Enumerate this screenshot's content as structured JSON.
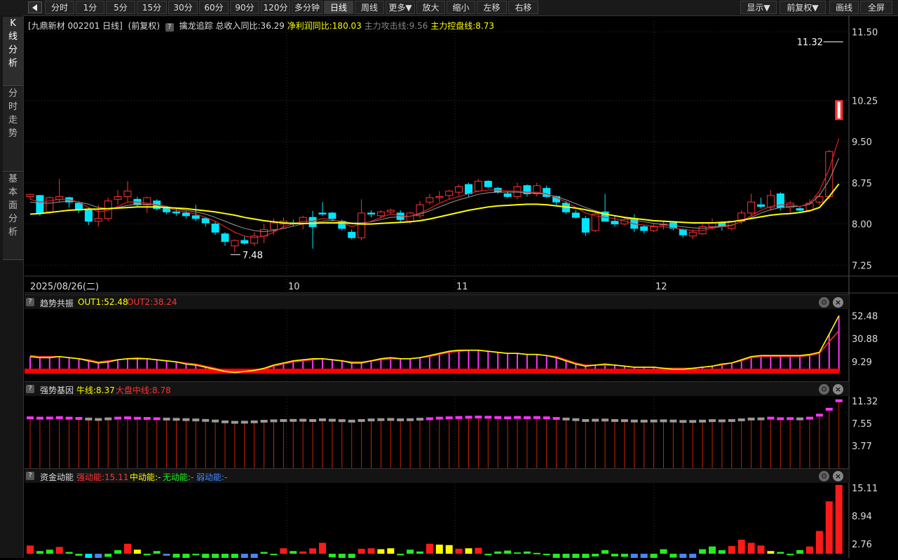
{
  "toolbar": {
    "periods": [
      "分时",
      "1分",
      "5分",
      "15分",
      "30分",
      "60分",
      "90分",
      "120分",
      "多分钟",
      "日线",
      "周线",
      "更多▼",
      "放大",
      "缩小",
      "左移",
      "右移"
    ],
    "active": "日线",
    "right": [
      "显示▼",
      "前复权▼",
      "画线",
      "全屏"
    ]
  },
  "sidebar": {
    "tabs": [
      "K线分析",
      "分时走势",
      "基本面分析"
    ]
  },
  "main": {
    "stock_label": "[九鼎新材 002201 日线]",
    "adjust": "(前复权)",
    "indicator_name": "擒龙追踪",
    "revenue": "总收入同比:36.29",
    "profit": "净利润同比:180.03",
    "attack": "主力攻击线:9.56",
    "control": "主力控盘线:8.73",
    "yticks": [
      "11.50",
      "10.25",
      "9.50",
      "8.75",
      "8.00",
      "7.25"
    ],
    "high_label": "11.32",
    "low_label": "7.48",
    "date_label": "2025/08/26(二)",
    "months": [
      "10",
      "11",
      "12"
    ]
  },
  "panel1": {
    "name": "趋势共振",
    "out1": "OUT1:52.48",
    "out2": "OUT2:38.24",
    "yticks": [
      "52.48",
      "30.88",
      "9.29"
    ]
  },
  "panel2": {
    "name": "强势基因",
    "bull": "牛线:8.37",
    "market": "大盘中线:8.78",
    "yticks": [
      "11.32",
      "7.55",
      "3.77"
    ]
  },
  "panel3": {
    "name": "资金动能",
    "strong": "强动能:15.11",
    "mid": "中动能:-",
    "none": "无动能:-",
    "weak": "弱动能:-",
    "yticks": [
      "15.11",
      "8.94",
      "2.76"
    ]
  },
  "colors": {
    "up": "#ff3333",
    "down": "#00e5ff",
    "yellow": "#ffff00",
    "magenta": "#ff33ff",
    "green": "#22ee22",
    "blue": "#4488ff"
  },
  "chart_data": {
    "type": "candlestick",
    "ylim": [
      7.1,
      11.7
    ],
    "ohlc": [
      [
        8.5,
        8.55,
        8.45,
        8.54
      ],
      [
        8.52,
        8.53,
        8.15,
        8.2
      ],
      [
        8.22,
        8.5,
        8.18,
        8.48
      ],
      [
        8.45,
        8.82,
        8.4,
        8.5
      ],
      [
        8.48,
        8.5,
        8.3,
        8.4
      ],
      [
        8.38,
        8.42,
        8.2,
        8.25
      ],
      [
        8.25,
        8.3,
        7.98,
        8.05
      ],
      [
        8.05,
        8.35,
        7.95,
        8.1
      ],
      [
        8.1,
        8.48,
        8.05,
        8.42
      ],
      [
        8.45,
        8.62,
        8.35,
        8.5
      ],
      [
        8.5,
        8.78,
        8.4,
        8.6
      ],
      [
        8.45,
        8.5,
        8.3,
        8.35
      ],
      [
        8.35,
        8.5,
        8.2,
        8.48
      ],
      [
        8.42,
        8.45,
        8.25,
        8.28
      ],
      [
        8.3,
        8.32,
        8.18,
        8.22
      ],
      [
        8.22,
        8.28,
        8.15,
        8.2
      ],
      [
        8.2,
        8.24,
        8.1,
        8.15
      ],
      [
        8.15,
        8.35,
        8.05,
        8.1
      ],
      [
        8.1,
        8.12,
        7.95,
        8.02
      ],
      [
        8.0,
        8.05,
        7.8,
        7.85
      ],
      [
        7.82,
        7.85,
        7.6,
        7.68
      ],
      [
        7.6,
        7.72,
        7.48,
        7.7
      ],
      [
        7.7,
        7.78,
        7.62,
        7.65
      ],
      [
        7.65,
        7.85,
        7.6,
        7.78
      ],
      [
        7.78,
        8.0,
        7.65,
        7.9
      ],
      [
        7.9,
        8.1,
        7.8,
        8.02
      ],
      [
        8.0,
        8.12,
        7.92,
        8.05
      ],
      [
        8.02,
        8.08,
        7.95,
        8.0
      ],
      [
        8.0,
        8.15,
        7.9,
        8.12
      ],
      [
        8.12,
        8.24,
        7.55,
        7.95
      ],
      [
        8.2,
        8.4,
        8.15,
        8.18
      ],
      [
        8.2,
        8.22,
        8.05,
        8.1
      ],
      [
        8.05,
        8.08,
        7.88,
        7.92
      ],
      [
        7.85,
        7.9,
        7.72,
        7.75
      ],
      [
        7.75,
        8.45,
        7.7,
        8.2
      ],
      [
        8.2,
        8.25,
        8.12,
        8.18
      ],
      [
        8.15,
        8.25,
        8.1,
        8.22
      ],
      [
        8.22,
        8.28,
        8.18,
        8.25
      ],
      [
        8.2,
        8.25,
        8.02,
        8.08
      ],
      [
        8.05,
        8.22,
        8.0,
        8.2
      ],
      [
        8.15,
        8.42,
        8.1,
        8.35
      ],
      [
        8.4,
        8.55,
        8.35,
        8.48
      ],
      [
        8.48,
        8.6,
        8.4,
        8.5
      ],
      [
        8.52,
        8.62,
        8.45,
        8.6
      ],
      [
        8.58,
        8.72,
        8.52,
        8.68
      ],
      [
        8.72,
        8.75,
        8.5,
        8.55
      ],
      [
        8.6,
        8.82,
        8.58,
        8.78
      ],
      [
        8.78,
        8.8,
        8.65,
        8.68
      ],
      [
        8.65,
        8.68,
        8.55,
        8.58
      ],
      [
        8.55,
        8.6,
        8.48,
        8.5
      ],
      [
        8.5,
        8.75,
        8.45,
        8.68
      ],
      [
        8.7,
        8.72,
        8.5,
        8.55
      ],
      [
        8.55,
        8.75,
        8.5,
        8.7
      ],
      [
        8.65,
        8.7,
        8.48,
        8.5
      ],
      [
        8.5,
        8.52,
        8.35,
        8.4
      ],
      [
        8.38,
        8.42,
        8.18,
        8.22
      ],
      [
        8.2,
        8.25,
        8.1,
        8.12
      ],
      [
        8.1,
        8.15,
        7.78,
        7.85
      ],
      [
        7.88,
        8.2,
        7.85,
        8.18
      ],
      [
        8.22,
        8.55,
        8.18,
        8.05
      ],
      [
        8.05,
        8.15,
        7.95,
        8.0
      ],
      [
        8.0,
        8.12,
        7.98,
        8.08
      ],
      [
        8.1,
        8.18,
        7.85,
        7.92
      ],
      [
        7.95,
        7.98,
        7.82,
        7.88
      ],
      [
        7.88,
        8.0,
        7.85,
        7.95
      ],
      [
        7.98,
        8.05,
        7.9,
        8.0
      ],
      [
        8.02,
        8.05,
        7.88,
        7.92
      ],
      [
        7.9,
        7.92,
        7.75,
        7.8
      ],
      [
        7.78,
        7.9,
        7.72,
        7.85
      ],
      [
        7.82,
        8.0,
        7.8,
        7.95
      ],
      [
        7.95,
        8.1,
        7.9,
        8.02
      ],
      [
        8.02,
        8.05,
        7.88,
        7.95
      ],
      [
        7.92,
        8.05,
        7.88,
        8.05
      ],
      [
        8.05,
        8.25,
        8.0,
        8.2
      ],
      [
        8.2,
        8.55,
        8.15,
        8.4
      ],
      [
        8.35,
        8.48,
        8.28,
        8.32
      ],
      [
        8.3,
        8.62,
        8.25,
        8.52
      ],
      [
        8.55,
        8.58,
        8.25,
        8.3
      ],
      [
        8.3,
        8.42,
        8.18,
        8.38
      ],
      [
        8.28,
        8.32,
        8.2,
        8.25
      ],
      [
        8.25,
        8.45,
        8.22,
        8.38
      ],
      [
        8.4,
        8.55,
        8.35,
        8.5
      ],
      [
        8.5,
        9.35,
        8.45,
        9.32
      ],
      [
        10.25,
        10.25,
        9.9,
        9.9
      ]
    ],
    "limit_up_last": true,
    "ma_yellow": [
      8.18,
      8.19,
      8.21,
      8.23,
      8.25,
      8.26,
      8.27,
      8.27,
      8.28,
      8.29,
      8.3,
      8.31,
      8.31,
      8.31,
      8.3,
      8.29,
      8.28,
      8.26,
      8.24,
      8.22,
      8.19,
      8.16,
      8.12,
      8.09,
      8.06,
      8.04,
      8.02,
      8.01,
      8.01,
      8.01,
      8.02,
      8.02,
      8.02,
      8.01,
      8.0,
      8.0,
      8.01,
      8.02,
      8.03,
      8.04,
      8.06,
      8.09,
      8.13,
      8.17,
      8.21,
      8.25,
      8.28,
      8.31,
      8.33,
      8.34,
      8.35,
      8.36,
      8.36,
      8.35,
      8.33,
      8.31,
      8.29,
      8.26,
      8.22,
      8.18,
      8.15,
      8.12,
      8.1,
      8.08,
      8.06,
      8.05,
      8.04,
      8.03,
      8.02,
      8.02,
      8.02,
      8.03,
      8.04,
      8.07,
      8.1,
      8.13,
      8.16,
      8.18,
      8.19,
      8.21,
      8.24,
      8.3,
      8.5,
      8.73
    ],
    "ma_red": [
      8.45,
      8.4,
      8.42,
      8.45,
      8.44,
      8.4,
      8.3,
      8.22,
      8.25,
      8.32,
      8.4,
      8.4,
      8.38,
      8.35,
      8.3,
      8.25,
      8.22,
      8.18,
      8.12,
      8.05,
      7.95,
      7.85,
      7.78,
      7.75,
      7.78,
      7.85,
      7.95,
      8.0,
      8.05,
      8.05,
      8.1,
      8.08,
      8.02,
      7.95,
      8.0,
      8.05,
      8.12,
      8.18,
      8.15,
      8.14,
      8.2,
      8.28,
      8.38,
      8.45,
      8.5,
      8.55,
      8.6,
      8.62,
      8.62,
      8.6,
      8.6,
      8.58,
      8.58,
      8.55,
      8.48,
      8.4,
      8.3,
      8.2,
      8.15,
      8.12,
      8.1,
      8.05,
      8.0,
      7.98,
      7.96,
      7.95,
      7.93,
      7.9,
      7.88,
      7.88,
      7.92,
      7.95,
      7.97,
      8.05,
      8.15,
      8.25,
      8.32,
      8.35,
      8.35,
      8.32,
      8.38,
      8.6,
      9.0,
      9.56
    ],
    "ma_gray": [
      8.4,
      8.38,
      8.38,
      8.4,
      8.42,
      8.4,
      8.36,
      8.3,
      8.28,
      8.3,
      8.34,
      8.36,
      8.36,
      8.35,
      8.32,
      8.28,
      8.25,
      8.22,
      8.18,
      8.12,
      8.05,
      7.98,
      7.92,
      7.88,
      7.86,
      7.88,
      7.92,
      7.96,
      8.0,
      8.02,
      8.05,
      8.06,
      8.05,
      8.02,
      8.02,
      8.04,
      8.08,
      8.12,
      8.13,
      8.14,
      8.18,
      8.24,
      8.31,
      8.38,
      8.44,
      8.49,
      8.54,
      8.57,
      8.58,
      8.58,
      8.58,
      8.57,
      8.56,
      8.54,
      8.5,
      8.44,
      8.37,
      8.3,
      8.24,
      8.19,
      8.15,
      8.11,
      8.07,
      8.04,
      8.01,
      7.99,
      7.97,
      7.95,
      7.93,
      7.92,
      7.94,
      7.96,
      7.98,
      8.04,
      8.12,
      8.2,
      8.26,
      8.3,
      8.32,
      8.32,
      8.36,
      8.52,
      8.8,
      9.2
    ],
    "panel1": {
      "ylim": [
        0,
        58
      ],
      "out1": [
        14,
        13,
        13,
        14,
        13,
        12,
        10,
        8,
        9,
        11,
        12,
        12,
        12,
        11,
        10,
        9,
        7,
        6,
        4,
        2,
        0,
        -1,
        0,
        1,
        3,
        6,
        8,
        10,
        11,
        12,
        12,
        11,
        10,
        8,
        8,
        10,
        12,
        13,
        12,
        12,
        13,
        15,
        17,
        19,
        20,
        20,
        20,
        19,
        18,
        17,
        17,
        16,
        16,
        15,
        13,
        10,
        7,
        5,
        6,
        7,
        6,
        5,
        4,
        4,
        4,
        3,
        2,
        2,
        3,
        4,
        5,
        7,
        8,
        11,
        14,
        15,
        15,
        15,
        15,
        15,
        16,
        18,
        35,
        52.48
      ],
      "out2": [
        15,
        14,
        14,
        14,
        13,
        12,
        11,
        9,
        10,
        11,
        12,
        13,
        12,
        11,
        10,
        9,
        8,
        7,
        5,
        3,
        1,
        0,
        0,
        1,
        2,
        5,
        7,
        9,
        10,
        11,
        12,
        11,
        10,
        9,
        9,
        10,
        11,
        12,
        12,
        12,
        13,
        14,
        16,
        18,
        19,
        20,
        20,
        19,
        18,
        17,
        17,
        16,
        16,
        15,
        14,
        11,
        8,
        6,
        6,
        6,
        6,
        5,
        4,
        4,
        4,
        3,
        3,
        3,
        3,
        4,
        5,
        6,
        8,
        10,
        13,
        14,
        14,
        14,
        14,
        14,
        15,
        17,
        28,
        38.24
      ]
    },
    "panel2": {
      "ylim": [
        0,
        12
      ],
      "bar_levels": [
        8.45,
        8.4,
        8.42,
        8.48,
        8.4,
        8.35,
        8.25,
        8.18,
        8.28,
        8.4,
        8.45,
        8.38,
        8.35,
        8.3,
        8.24,
        8.2,
        8.15,
        8.1,
        8.02,
        7.92,
        7.78,
        7.7,
        7.72,
        7.78,
        7.88,
        7.95,
        8.0,
        8.02,
        8.05,
        8.0,
        8.12,
        8.05,
        7.98,
        7.9,
        8.0,
        8.1,
        8.15,
        8.18,
        8.12,
        8.14,
        8.22,
        8.3,
        8.4,
        8.45,
        8.5,
        8.55,
        8.58,
        8.55,
        8.5,
        8.45,
        8.52,
        8.48,
        8.5,
        8.45,
        8.35,
        8.25,
        8.15,
        8.0,
        8.05,
        8.08,
        8.0,
        7.98,
        7.92,
        7.9,
        7.92,
        7.95,
        7.92,
        7.85,
        7.85,
        7.9,
        7.98,
        7.95,
        8.0,
        8.12,
        8.25,
        8.28,
        8.4,
        8.3,
        8.32,
        8.28,
        8.4,
        8.9,
        9.9,
        11.32
      ]
    },
    "panel3": {
      "ylim": [
        0,
        16
      ],
      "values": [
        1.8,
        0.6,
        0.9,
        1.5,
        0.4,
        -0.5,
        -2.5,
        -2.0,
        -0.8,
        0.8,
        2.2,
        0.9,
        -0.4,
        0.6,
        -0.5,
        -1.0,
        -1.2,
        -0.4,
        -1.2,
        -1.9,
        -2.4,
        -2.7,
        -1.7,
        -1.5,
        0.4,
        -0.3,
        1.2,
        0.6,
        0.5,
        1.2,
        2.4,
        -0.9,
        -1.3,
        -1.7,
        1.1,
        1.2,
        1.0,
        1.2,
        -0.4,
        0.9,
        0.5,
        2.2,
        2.0,
        1.9,
        1.1,
        1.2,
        1.3,
        -0.4,
        0.5,
        0.7,
        0.3,
        0.5,
        0.2,
        -0.3,
        -1.5,
        -2.6,
        -2.7,
        -3.2,
        -0.7,
        0.8,
        -0.7,
        -0.8,
        -1.3,
        -1.8,
        -1.2,
        1.0,
        -1.0,
        -1.5,
        -1.1,
        1.0,
        1.6,
        0.8,
        1.7,
        3.1,
        2.4,
        1.8,
        0.6,
        0.4,
        -0.3,
        0.8,
        1.6,
        5.0,
        11.5,
        15.11
      ],
      "colors": [
        "red",
        "green",
        "green",
        "red",
        "green",
        "green",
        "cyan",
        "blue",
        "green",
        "green",
        "red",
        "yellow",
        "green",
        "green",
        "blue",
        "green",
        "green",
        "green",
        "green",
        "green",
        "green",
        "green",
        "blue",
        "blue",
        "green",
        "green",
        "red",
        "green",
        "red",
        "red",
        "red",
        "green",
        "green",
        "green",
        "red",
        "red",
        "yellow",
        "yellow",
        "green",
        "green",
        "green",
        "red",
        "yellow",
        "yellow",
        "red",
        "yellow",
        "red",
        "green",
        "green",
        "green",
        "green",
        "green",
        "green",
        "green",
        "green",
        "green",
        "green",
        "green",
        "green",
        "green",
        "green",
        "green",
        "blue",
        "blue",
        "green",
        "green",
        "green",
        "blue",
        "blue",
        "green",
        "green",
        "green",
        "red",
        "red",
        "red",
        "red",
        "yellow",
        "green",
        "green",
        "green",
        "red",
        "red",
        "red",
        "red"
      ]
    }
  }
}
